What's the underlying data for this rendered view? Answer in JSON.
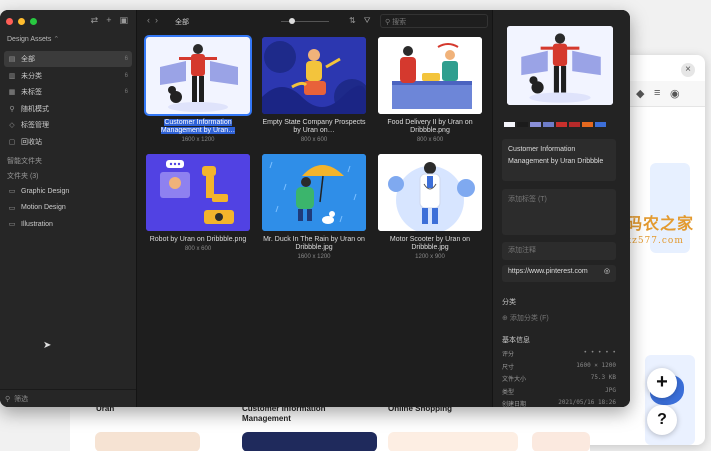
{
  "app": {
    "library_name": "Design Assets",
    "library_chevron": "⌃",
    "toolbar": {
      "back": "‹",
      "forward": "›",
      "current_folder": "全部",
      "search_placeholder": "搜索"
    },
    "nav": [
      {
        "label": "全部",
        "count": "6",
        "icon": "all-items-icon",
        "active": true
      },
      {
        "label": "未分类",
        "count": "6",
        "icon": "uncategorized-icon"
      },
      {
        "label": "未标签",
        "count": "6",
        "icon": "untagged-icon"
      },
      {
        "label": "随机模式",
        "count": "",
        "icon": "random-icon"
      },
      {
        "label": "标签管理",
        "count": "",
        "icon": "tag-icon"
      },
      {
        "label": "回收站",
        "count": "",
        "icon": "trash-icon"
      }
    ],
    "smart_folders_title": "智能文件夹",
    "folders_title": "文件夹 (3)",
    "folders": [
      "Graphic Design",
      "Motion Design",
      "Illustration"
    ],
    "filter_placeholder": "筛选",
    "assets": [
      {
        "name": "Customer Information Management by Uran…",
        "size": "1600 x 1200",
        "selected": true
      },
      {
        "name": "Empty State Company Prospects by Uran on…",
        "size": "800 x 600"
      },
      {
        "name": "Food Delivery II by Uran on Dribbble.png",
        "size": "800 x 600"
      },
      {
        "name": "Robot by Uran on Dribbble.png",
        "size": "800 x 600"
      },
      {
        "name": "Mr. Duck In The Rain by Uran on Dribbble.jpg",
        "size": "1600 x 1200"
      },
      {
        "name": "Motor Scooter by Uran on Dribbble.jpg",
        "size": "1200 x 900"
      }
    ],
    "inspector": {
      "palette": [
        "#f4f5fb",
        "#1b1b1b",
        "#8a8fd8",
        "#6e7dc9",
        "#c9302c",
        "#b52a2a",
        "#e4681f",
        "#3d6fd8"
      ],
      "title": "Customer Information Management by Uran Dribbble",
      "tags_placeholder": "添加标签 (T)",
      "note_placeholder": "添加注释",
      "url": "https://www.pinterest.com",
      "category_label": "分类",
      "add_category": "添加分类 (F)",
      "basic_info_label": "基本信息",
      "info": [
        {
          "key": "评分",
          "value": "• • • • •"
        },
        {
          "key": "尺寸",
          "value": "1600 × 1200"
        },
        {
          "key": "文件大小",
          "value": "75.3 KB"
        },
        {
          "key": "类型",
          "value": "JPG"
        },
        {
          "key": "创建日期",
          "value": "2021/05/16 18:26"
        }
      ]
    }
  },
  "background": {
    "captions": [
      "Uran",
      "Customer Information Management",
      "Online Shopping"
    ],
    "fab_add": "+",
    "fab_help": "?",
    "watermark_cn": "码农之家",
    "watermark_url": "xz577.com"
  },
  "colors": {
    "accent": "#3478f6",
    "traffic_red": "#ff5f57",
    "traffic_yellow": "#febc2e",
    "traffic_green": "#28c840"
  }
}
